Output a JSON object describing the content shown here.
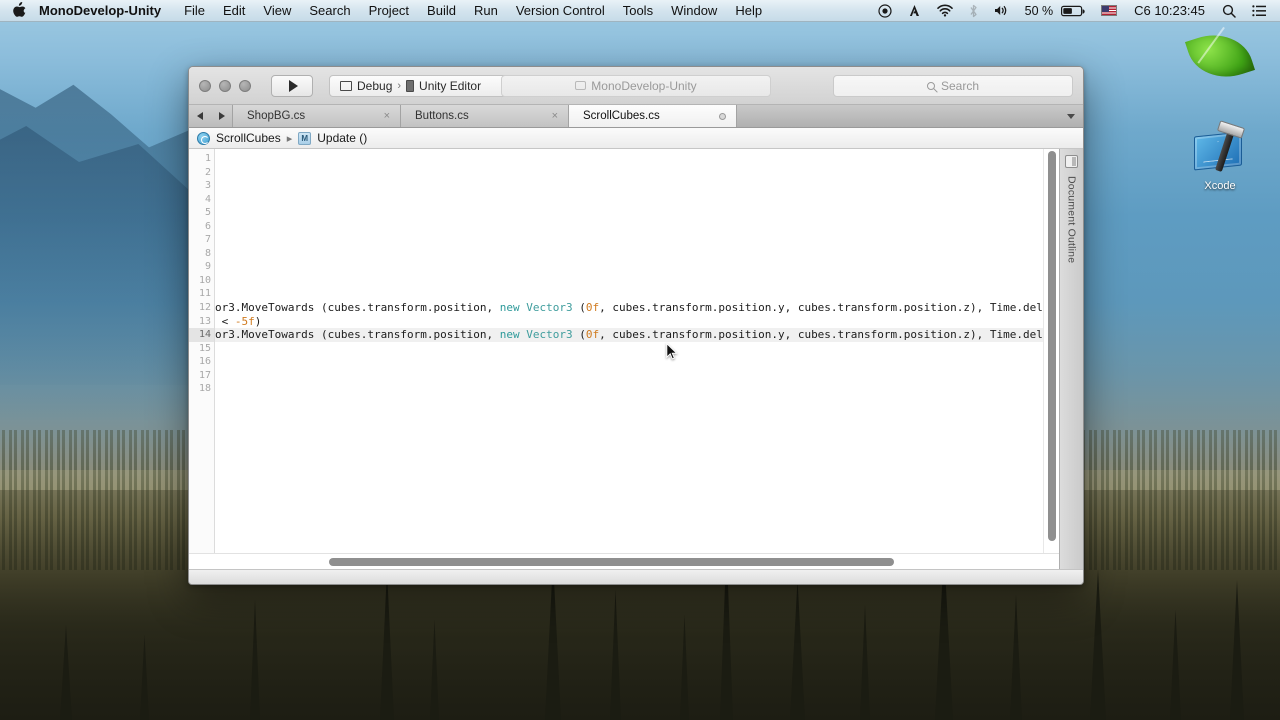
{
  "menubar": {
    "apple_glyph": "",
    "app_name": "MonoDevelop-Unity",
    "items": [
      "File",
      "Edit",
      "View",
      "Search",
      "Project",
      "Build",
      "Run",
      "Version Control",
      "Tools",
      "Window",
      "Help"
    ],
    "status": {
      "record_icon": "record-icon",
      "app_icon": "adobe-icon",
      "wifi_icon": "wifi-icon",
      "bluetooth_icon": "bluetooth-icon",
      "volume_icon": "volume-icon",
      "battery_percent": "50 %",
      "battery_icon": "battery-icon",
      "flag_icon": "us-flag-icon",
      "clock": "C6 10:23:45",
      "search_icon": "spotlight-search-icon",
      "notification_icon": "notification-center-icon"
    }
  },
  "window": {
    "toolbar": {
      "run_button": "run-button",
      "config_target": "Debug",
      "config_sep": "›",
      "config_device": "Unity Editor",
      "title": "MonoDevelop-Unity",
      "search_placeholder": "Search"
    },
    "tabs": {
      "back_label": "◀",
      "forward_label": "▶",
      "items": [
        {
          "name": "ShopBG.cs",
          "active": false,
          "close": "×",
          "modified": false
        },
        {
          "name": "Buttons.cs",
          "active": false,
          "close": "×",
          "modified": false
        },
        {
          "name": "ScrollCubes.cs",
          "active": true,
          "close": "×",
          "modified": true
        }
      ]
    },
    "breadcrumb": {
      "class_icon": "class-icon",
      "class_name": "ScrollCubes",
      "separator": "▸",
      "method_icon": "method-icon",
      "method_name": "Update ()"
    },
    "outline": {
      "pane_icon": "outline-pane-icon",
      "label": "Document Outline"
    }
  },
  "editor": {
    "line_numbers": [
      "1",
      "2",
      "3",
      "4",
      "5",
      "6",
      "7",
      "8",
      "9",
      "10",
      "11",
      "12",
      "13",
      "14",
      "15",
      "16",
      "17",
      "18"
    ],
    "current_line": 14,
    "lines": [
      {
        "n": 12,
        "segments": [
          {
            "t": "or3.MoveTowards (cubes.transform.position, ",
            "c": "plain"
          },
          {
            "t": "new ",
            "c": "keyword"
          },
          {
            "t": "Vector3 ",
            "c": "type"
          },
          {
            "t": "(",
            "c": "plain"
          },
          {
            "t": "0f",
            "c": "number"
          },
          {
            "t": ", cubes.transform.position.y, cubes.transform.position.z), Time.deltaT",
            "c": "plain"
          }
        ]
      },
      {
        "n": 13,
        "segments": [
          {
            "t": " < ",
            "c": "plain"
          },
          {
            "t": "-5f",
            "c": "number"
          },
          {
            "t": ")",
            "c": "plain"
          }
        ]
      },
      {
        "n": 14,
        "segments": [
          {
            "t": "or3.MoveTowards (cubes.transform.position, ",
            "c": "plain"
          },
          {
            "t": "new ",
            "c": "keyword"
          },
          {
            "t": "Vector3 ",
            "c": "type"
          },
          {
            "t": "(",
            "c": "plain"
          },
          {
            "t": "0f",
            "c": "number"
          },
          {
            "t": ", cubes.transform.position.y, cubes.transform.position.z), Time.deltaT",
            "c": "plain"
          }
        ]
      }
    ]
  },
  "desktop": {
    "icons": [
      {
        "name": "leaf-icon",
        "label": ""
      },
      {
        "name": "xcode-icon",
        "label": "Xcode"
      }
    ]
  },
  "colors": {
    "accent_keyword": "#2e9a9a",
    "accent_number": "#d07a1e",
    "menubar_bg": "#d4e4ee",
    "window_chrome": "#d2d2d2"
  }
}
